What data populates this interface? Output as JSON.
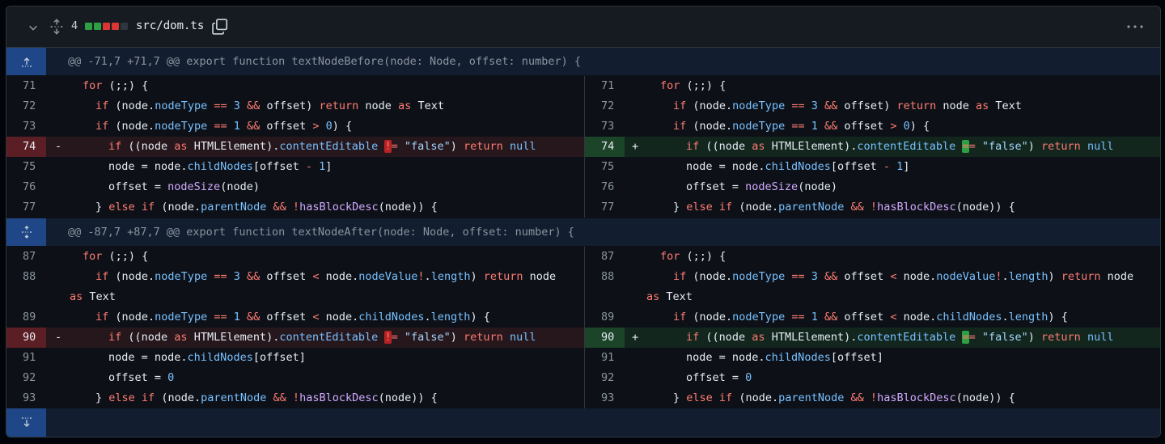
{
  "file_header": {
    "changes_count": "4",
    "path": "src/dom.ts",
    "diffstat_colors": [
      "#2ea043",
      "#2ea043",
      "#da3633",
      "#da3633",
      "#30363d"
    ]
  },
  "hunks": [
    {
      "header": "@@ -71,7 +71,7 @@ export function textNodeBefore(node: Node, offset: number) {"
    },
    {
      "header": "@@ -87,7 +87,7 @@ export function textNodeAfter(node: Node, offset: number) {"
    }
  ],
  "line_numbers": {
    "h1": [
      "71",
      "72",
      "73",
      "74",
      "75",
      "76",
      "77"
    ],
    "h2": [
      "87",
      "88",
      "89",
      "90",
      "91",
      "92",
      "93"
    ]
  },
  "markers": {
    "del": "-",
    "add": "+"
  },
  "code": {
    "for_kw": "for",
    "for_rest": " (;;) {",
    "if_kw": "if",
    "return_kw": "return",
    "as_kw": "as",
    "else_kw": "else",
    "null_kw": "null",
    "node": "node",
    "nodeType": "nodeType",
    "parentNode": "parentNode",
    "childNodes": "childNodes",
    "contentEditable": "contentEditable",
    "nodeValue": "nodeValue",
    "length": "length",
    "nodeSize": "nodeSize",
    "hasBlockDesc": "hasBlockDesc",
    "false_str": "\"false\"",
    "Text": "Text",
    "HTMLElement": "HTMLElement"
  }
}
